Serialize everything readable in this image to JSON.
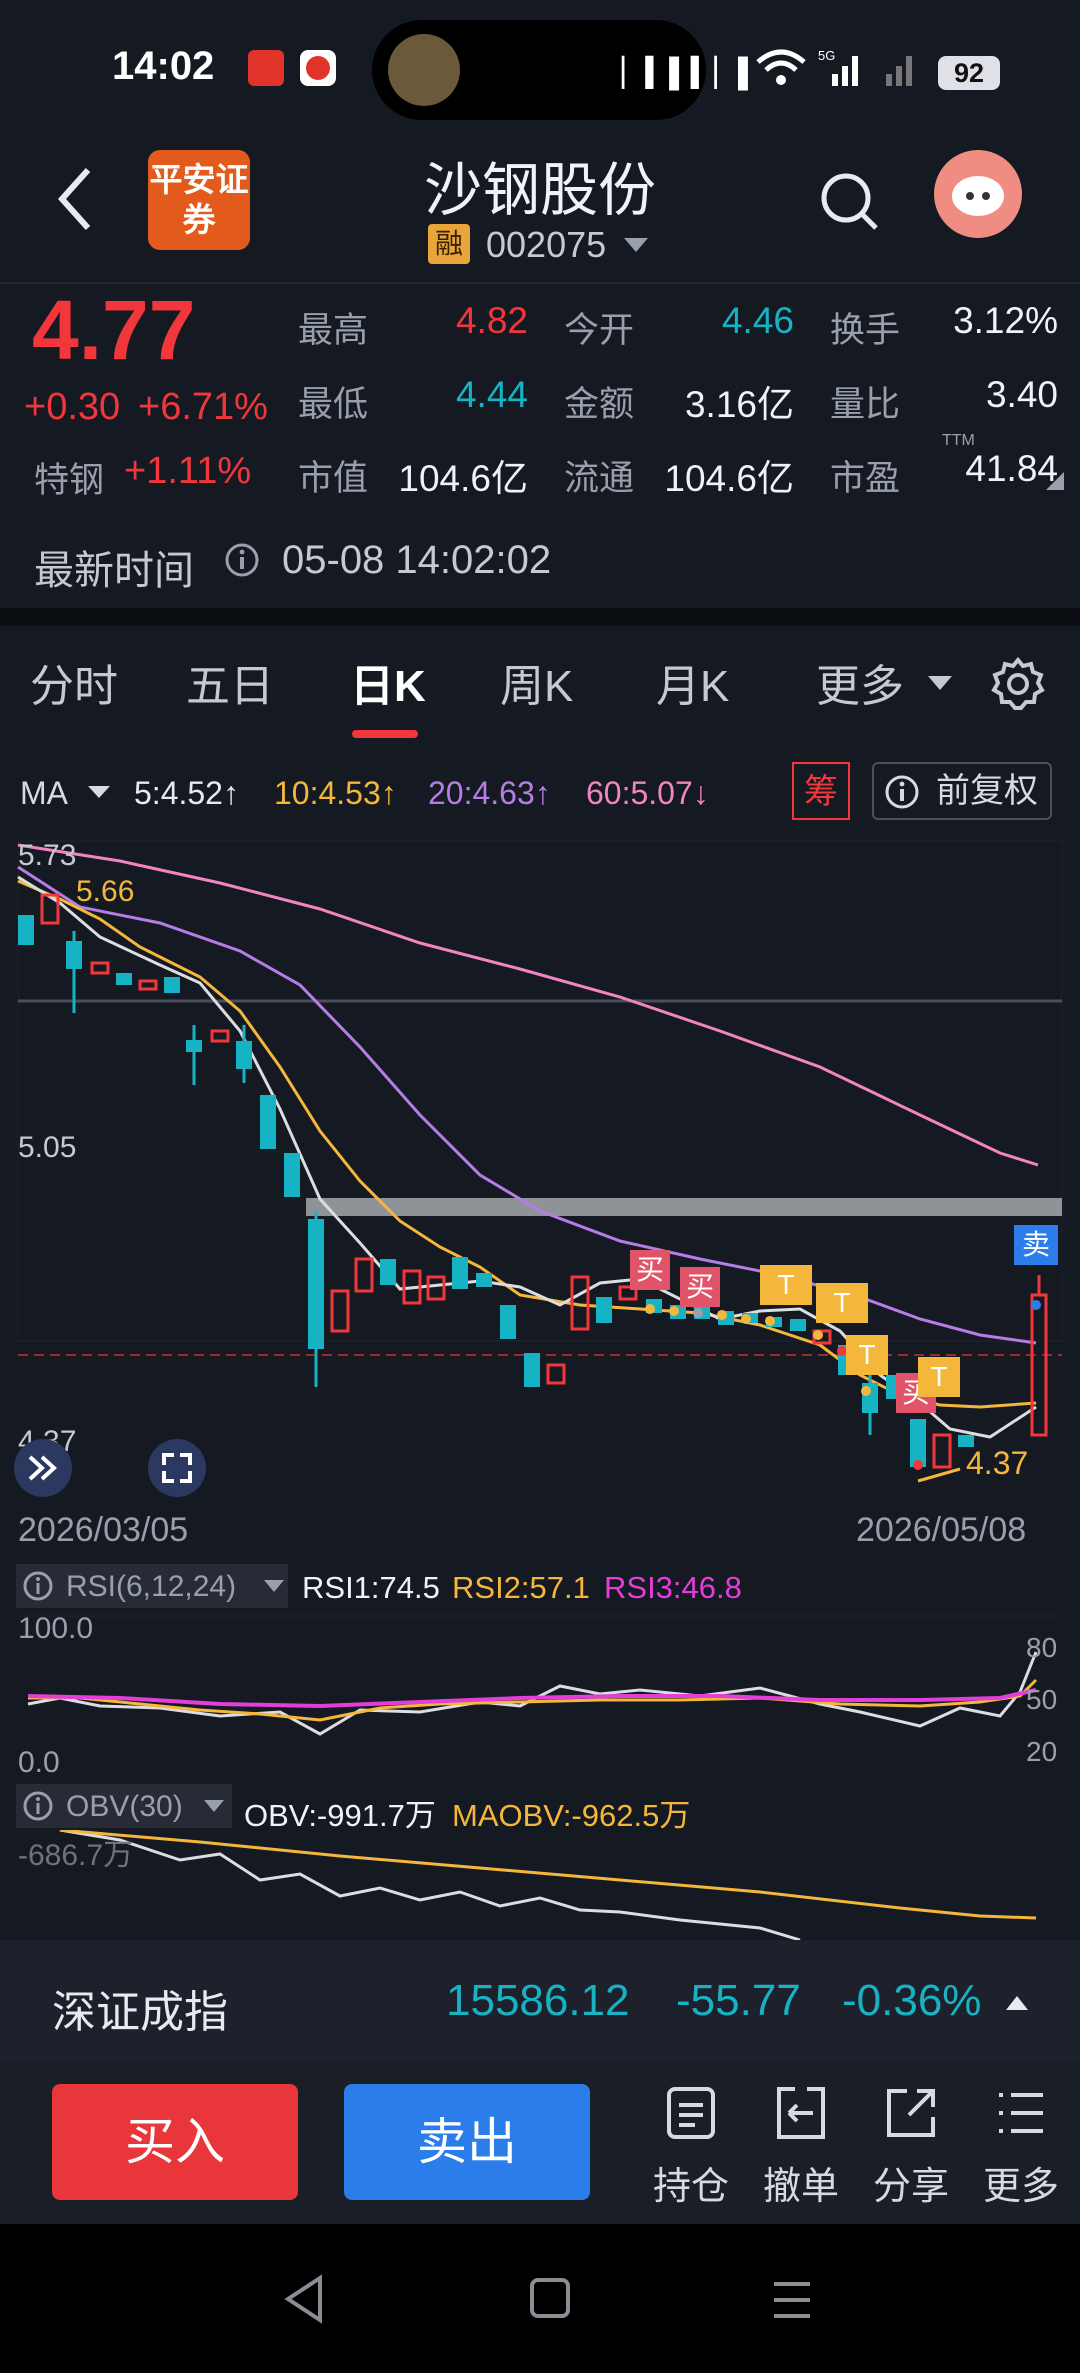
{
  "status_bar": {
    "time": "14:02",
    "battery": "92",
    "network": "5G"
  },
  "header": {
    "title": "沙钢股份",
    "margin_badge": "融",
    "code": "002075",
    "broker_logo": "平安证券"
  },
  "quote": {
    "price": "4.77",
    "change": "+0.30",
    "change_pct": "+6.71%",
    "sector_name": "特钢",
    "sector_change": "+1.11%",
    "rows": [
      [
        {
          "label": "最高",
          "value": "4.82",
          "color": "red"
        },
        {
          "label": "今开",
          "value": "4.46",
          "color": "cyan"
        },
        {
          "label": "换手",
          "value": "3.12%",
          "color": "white"
        }
      ],
      [
        {
          "label": "最低",
          "value": "4.44",
          "color": "cyan"
        },
        {
          "label": "金额",
          "value": "3.16亿",
          "color": "white"
        },
        {
          "label": "量比",
          "value": "3.40",
          "color": "white"
        }
      ],
      [
        {
          "label": "市值",
          "value": "104.6亿",
          "color": "white"
        },
        {
          "label": "流通",
          "value": "104.6亿",
          "color": "white"
        },
        {
          "label": "市盈",
          "value": "41.84",
          "color": "white",
          "sup": "TTM"
        }
      ]
    ],
    "latest_time_label": "最新时间",
    "latest_time": "05-08 14:02:02"
  },
  "tabs": [
    "分时",
    "五日",
    "日K",
    "周K",
    "月K",
    "更多"
  ],
  "active_tab": "日K",
  "ma_bar": {
    "label": "MA",
    "items": [
      {
        "text": "5:4.52↑",
        "color": "#e8eaef"
      },
      {
        "text": "10:4.53↑",
        "color": "#f5b73b"
      },
      {
        "text": "20:4.63↑",
        "color": "#b57de6"
      },
      {
        "text": "60:5.07↓",
        "color": "#f285bf"
      }
    ],
    "chou": "筹",
    "fuquan": "前复权"
  },
  "kline": {
    "price_labels": {
      "top": "5.73",
      "mid": "5.05",
      "bottom": "4.37",
      "high_mark": "5.66",
      "low_mark": "4.37"
    },
    "date_start": "2026/03/05",
    "date_end": "2026/05/08",
    "buy_tag": "买",
    "sell_tag": "卖",
    "t_tag": "T"
  },
  "rsi": {
    "label": "RSI(6,12,24)",
    "rsi1": "RSI1:74.5",
    "rsi2": "RSI2:57.1",
    "rsi3": "RSI3:46.8",
    "top": "100.0",
    "bottom": "0.0",
    "right_80": "80",
    "right_50": "50",
    "right_20": "20"
  },
  "obv": {
    "label": "OBV(30)",
    "obv": "OBV:-991.7万",
    "maobv": "MAOBV:-962.5万",
    "axis": "-686.7万"
  },
  "index_bar": {
    "name": "深证成指",
    "value": "15586.12",
    "change": "-55.77",
    "pct": "-0.36%"
  },
  "actions": {
    "buy": "买入",
    "sell": "卖出",
    "hold": "持仓",
    "cancel": "撤单",
    "share": "分享",
    "more": "更多"
  },
  "colors": {
    "up": "#f2373c",
    "down": "#16b3c4",
    "accent_blue": "#2b7de9"
  }
}
